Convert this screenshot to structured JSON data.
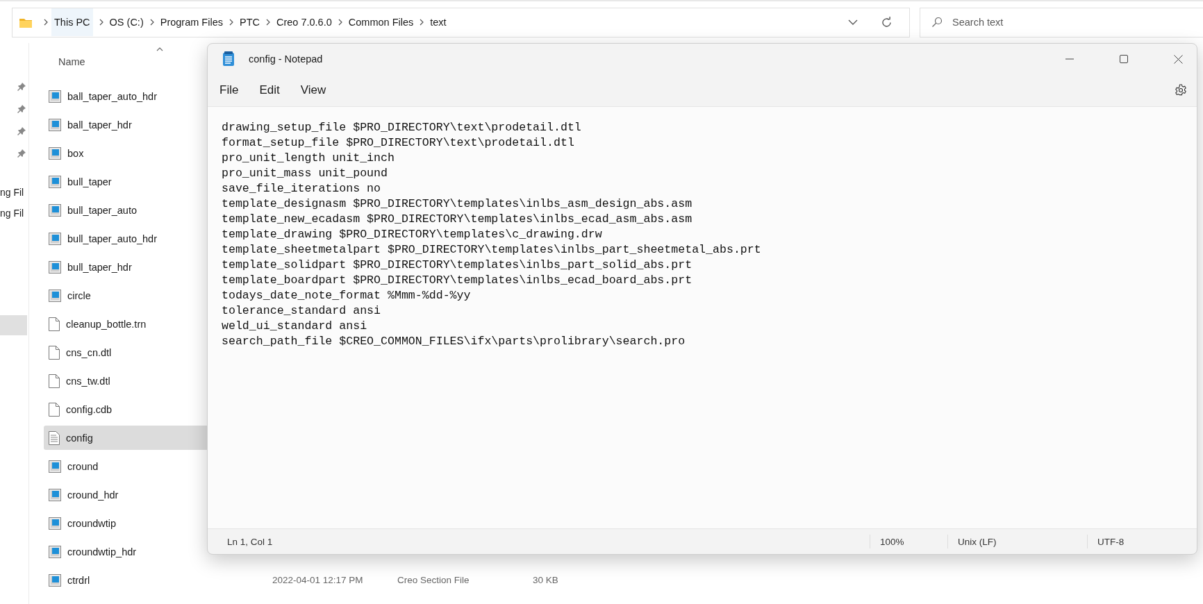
{
  "address_bar": {
    "crumbs": [
      "This PC",
      "OS (C:)",
      "Program Files",
      "PTC",
      "Creo 7.0.6.0",
      "Common Files",
      "text"
    ]
  },
  "search": {
    "placeholder": "Search text"
  },
  "nav_pane": {
    "items": [
      {
        "label": "ng Fil"
      },
      {
        "label": "ng Fil"
      }
    ]
  },
  "file_list": {
    "columns": [
      {
        "label": "Name"
      }
    ],
    "rows": [
      {
        "name": "ball_taper_auto_hdr",
        "kind": "model",
        "selected": false
      },
      {
        "name": "ball_taper_hdr",
        "kind": "model",
        "selected": false
      },
      {
        "name": "box",
        "kind": "model",
        "selected": false
      },
      {
        "name": "bull_taper",
        "kind": "model",
        "selected": false
      },
      {
        "name": "bull_taper_auto",
        "kind": "model",
        "selected": false
      },
      {
        "name": "bull_taper_auto_hdr",
        "kind": "model",
        "selected": false
      },
      {
        "name": "bull_taper_hdr",
        "kind": "model",
        "selected": false
      },
      {
        "name": "circle",
        "kind": "model",
        "selected": false
      },
      {
        "name": "cleanup_bottle.trn",
        "kind": "blank",
        "selected": false
      },
      {
        "name": "cns_cn.dtl",
        "kind": "blank",
        "selected": false
      },
      {
        "name": "cns_tw.dtl",
        "kind": "blank",
        "selected": false
      },
      {
        "name": "config.cdb",
        "kind": "blank",
        "selected": false
      },
      {
        "name": "config",
        "kind": "text",
        "selected": true
      },
      {
        "name": "cround",
        "kind": "model",
        "selected": false
      },
      {
        "name": "cround_hdr",
        "kind": "model",
        "selected": false
      },
      {
        "name": "croundwtip",
        "kind": "model",
        "selected": false
      },
      {
        "name": "croundwtip_hdr",
        "kind": "model",
        "selected": false
      },
      {
        "name": "ctrdrl",
        "kind": "model",
        "selected": false,
        "date": "2022-04-01 12:17 PM",
        "type": "Creo Section File",
        "size": "30 KB"
      }
    ]
  },
  "notepad": {
    "title": "config - Notepad",
    "menu": [
      "File",
      "Edit",
      "View"
    ],
    "lines": [
      "drawing_setup_file $PRO_DIRECTORY\\text\\prodetail.dtl",
      "format_setup_file $PRO_DIRECTORY\\text\\prodetail.dtl",
      "pro_unit_length unit_inch",
      "pro_unit_mass unit_pound",
      "save_file_iterations no",
      "template_designasm $PRO_DIRECTORY\\templates\\inlbs_asm_design_abs.asm",
      "template_new_ecadasm $PRO_DIRECTORY\\templates\\inlbs_ecad_asm_abs.asm",
      "template_drawing $PRO_DIRECTORY\\templates\\c_drawing.drw",
      "template_sheetmetalpart $PRO_DIRECTORY\\templates\\inlbs_part_sheetmetal_abs.prt",
      "template_solidpart $PRO_DIRECTORY\\templates\\inlbs_part_solid_abs.prt",
      "template_boardpart $PRO_DIRECTORY\\templates\\inlbs_ecad_board_abs.prt",
      "todays_date_note_format %Mmm-%dd-%yy",
      "tolerance_standard ansi",
      "weld_ui_standard ansi",
      "search_path_file $CREO_COMMON_FILES\\ifx\\parts\\prolibrary\\search.pro"
    ],
    "status": {
      "position": "Ln 1, Col 1",
      "zoom": "100%",
      "line_ending": "Unix (LF)",
      "encoding": "UTF-8"
    }
  }
}
